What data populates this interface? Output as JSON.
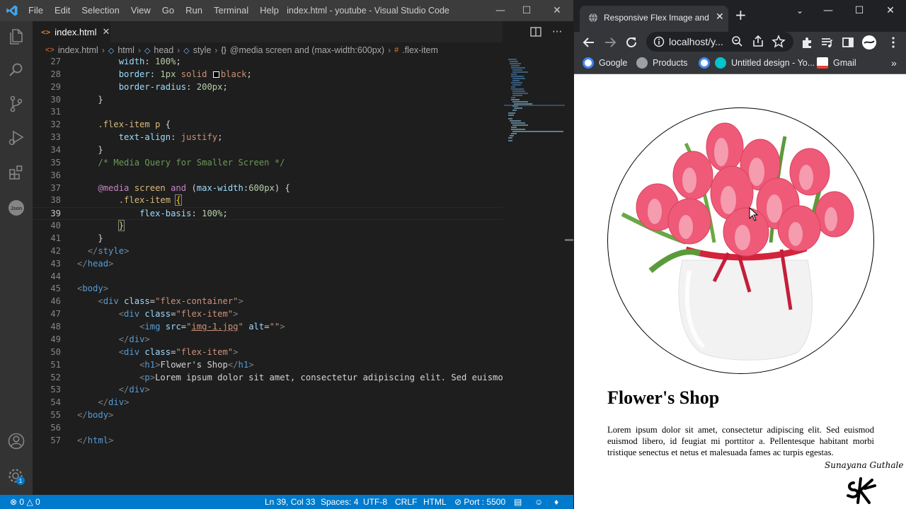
{
  "vscode": {
    "menu": [
      "File",
      "Edit",
      "Selection",
      "View",
      "Go",
      "Run",
      "Terminal",
      "Help"
    ],
    "window_title": "index.html - youtube - Visual Studio Code",
    "tab": {
      "label": "index.html",
      "icon": "html-file-icon"
    },
    "breadcrumb": [
      "index.html",
      "html",
      "head",
      "style",
      "@media screen and (max-width:600px)",
      ".flex-item"
    ],
    "activity_icons": [
      "explorer-icon",
      "search-icon",
      "source-control-icon",
      "run-debug-icon",
      "extensions-icon",
      "json-icon",
      "account-icon",
      "manage-gear-icon"
    ],
    "manage_badge": "1",
    "status": {
      "problems_errors": "0",
      "problems_warnings": "0",
      "position": "Ln 39, Col 33",
      "spaces": "Spaces: 4",
      "encoding": "UTF-8",
      "eol": "CRLF",
      "language": "HTML",
      "port": "Port : 5500"
    },
    "colors": {
      "statusbar": "#007acc",
      "activitybar": "#333333",
      "editor_bg": "#1e1e1e",
      "titlebar": "#3c3c3c"
    }
  },
  "code_lines": [
    {
      "n": "27",
      "tokens": [
        [
          "        ",
          "txt"
        ],
        [
          "width",
          "prop"
        ],
        [
          ": ",
          "txt"
        ],
        [
          "100%",
          "num"
        ],
        [
          ";",
          "txt"
        ]
      ]
    },
    {
      "n": "28",
      "tokens": [
        [
          "        ",
          "txt"
        ],
        [
          "border",
          "prop"
        ],
        [
          ": ",
          "txt"
        ],
        [
          "1px",
          "num"
        ],
        [
          " solid ",
          "str"
        ],
        [
          "#box",
          "box"
        ],
        [
          "black",
          "str"
        ],
        [
          ";",
          "txt"
        ]
      ]
    },
    {
      "n": "29",
      "tokens": [
        [
          "        ",
          "txt"
        ],
        [
          "border-radius",
          "prop"
        ],
        [
          ": ",
          "txt"
        ],
        [
          "200px",
          "num"
        ],
        [
          ";",
          "txt"
        ]
      ]
    },
    {
      "n": "30",
      "tokens": [
        [
          "    }",
          "txt"
        ]
      ]
    },
    {
      "n": "31",
      "tokens": []
    },
    {
      "n": "32",
      "tokens": [
        [
          "    ",
          "txt"
        ],
        [
          ".flex-item p",
          "sel"
        ],
        [
          " {",
          "txt"
        ]
      ]
    },
    {
      "n": "33",
      "tokens": [
        [
          "        ",
          "txt"
        ],
        [
          "text-align",
          "prop"
        ],
        [
          ": ",
          "txt"
        ],
        [
          "justify",
          "str"
        ],
        [
          ";",
          "txt"
        ]
      ]
    },
    {
      "n": "34",
      "tokens": [
        [
          "    }",
          "txt"
        ]
      ]
    },
    {
      "n": "35",
      "tokens": [
        [
          "    ",
          "txt"
        ],
        [
          "/* Media Query for Smaller Screen */",
          "com"
        ]
      ]
    },
    {
      "n": "36",
      "tokens": []
    },
    {
      "n": "37",
      "tokens": [
        [
          "    ",
          "txt"
        ],
        [
          "@media",
          "kw"
        ],
        [
          " screen ",
          "sel"
        ],
        [
          "and",
          "kw"
        ],
        [
          " (",
          "txt"
        ],
        [
          "max-width",
          "prop"
        ],
        [
          ":",
          "txt"
        ],
        [
          "600px",
          "num"
        ],
        [
          ") {",
          "txt"
        ]
      ]
    },
    {
      "n": "38",
      "tokens": [
        [
          "        ",
          "txt"
        ],
        [
          ".flex-item",
          "sel"
        ],
        [
          " ",
          "txt"
        ],
        [
          "{",
          "bbox"
        ]
      ]
    },
    {
      "n": "39",
      "tokens": [
        [
          "            ",
          "txt"
        ],
        [
          "flex-basis",
          "prop"
        ],
        [
          ": ",
          "txt"
        ],
        [
          "100%",
          "num"
        ],
        [
          ";",
          "txt"
        ]
      ],
      "current": true
    },
    {
      "n": "40",
      "tokens": [
        [
          "        ",
          "txt"
        ],
        [
          "}",
          "bbox"
        ]
      ]
    },
    {
      "n": "41",
      "tokens": [
        [
          "    }",
          "txt"
        ]
      ]
    },
    {
      "n": "42",
      "tokens": [
        [
          "  ",
          "txt"
        ],
        [
          "</",
          "punc"
        ],
        [
          "style",
          "tag"
        ],
        [
          ">",
          "punc"
        ]
      ]
    },
    {
      "n": "43",
      "tokens": [
        [
          "</",
          "punc"
        ],
        [
          "head",
          "tag"
        ],
        [
          ">",
          "punc"
        ]
      ]
    },
    {
      "n": "44",
      "tokens": []
    },
    {
      "n": "45",
      "tokens": [
        [
          "<",
          "punc"
        ],
        [
          "body",
          "tag"
        ],
        [
          ">",
          "punc"
        ]
      ]
    },
    {
      "n": "46",
      "tokens": [
        [
          "    ",
          "txt"
        ],
        [
          "<",
          "punc"
        ],
        [
          "div",
          "tag"
        ],
        [
          " ",
          "txt"
        ],
        [
          "class",
          "attr"
        ],
        [
          "=",
          "txt"
        ],
        [
          "\"flex-container\"",
          "str"
        ],
        [
          ">",
          "punc"
        ]
      ]
    },
    {
      "n": "47",
      "tokens": [
        [
          "        ",
          "txt"
        ],
        [
          "<",
          "punc"
        ],
        [
          "div",
          "tag"
        ],
        [
          " ",
          "txt"
        ],
        [
          "class",
          "attr"
        ],
        [
          "=",
          "txt"
        ],
        [
          "\"flex-item\"",
          "str"
        ],
        [
          ">",
          "punc"
        ]
      ]
    },
    {
      "n": "48",
      "tokens": [
        [
          "            ",
          "txt"
        ],
        [
          "<",
          "punc"
        ],
        [
          "img",
          "tag"
        ],
        [
          " ",
          "txt"
        ],
        [
          "src",
          "attr"
        ],
        [
          "=",
          "txt"
        ],
        [
          "\"",
          "str"
        ],
        [
          "img-1.jpg",
          "strul"
        ],
        [
          "\"",
          "str"
        ],
        [
          " ",
          "txt"
        ],
        [
          "alt",
          "attr"
        ],
        [
          "=",
          "txt"
        ],
        [
          "\"\"",
          "str"
        ],
        [
          ">",
          "punc"
        ]
      ]
    },
    {
      "n": "49",
      "tokens": [
        [
          "        ",
          "txt"
        ],
        [
          "</",
          "punc"
        ],
        [
          "div",
          "tag"
        ],
        [
          ">",
          "punc"
        ]
      ]
    },
    {
      "n": "50",
      "tokens": [
        [
          "        ",
          "txt"
        ],
        [
          "<",
          "punc"
        ],
        [
          "div",
          "tag"
        ],
        [
          " ",
          "txt"
        ],
        [
          "class",
          "attr"
        ],
        [
          "=",
          "txt"
        ],
        [
          "\"flex-item\"",
          "str"
        ],
        [
          ">",
          "punc"
        ]
      ]
    },
    {
      "n": "51",
      "tokens": [
        [
          "            ",
          "txt"
        ],
        [
          "<",
          "punc"
        ],
        [
          "h1",
          "tag"
        ],
        [
          ">",
          "punc"
        ],
        [
          "Flower's Shop",
          "txt"
        ],
        [
          "</",
          "punc"
        ],
        [
          "h1",
          "tag"
        ],
        [
          ">",
          "punc"
        ]
      ]
    },
    {
      "n": "52",
      "tokens": [
        [
          "            ",
          "txt"
        ],
        [
          "<",
          "punc"
        ],
        [
          "p",
          "tag"
        ],
        [
          ">",
          "punc"
        ],
        [
          "Lorem ipsum dolor sit amet, consectetur adipiscing elit. Sed euismod",
          "txt"
        ]
      ]
    },
    {
      "n": "53",
      "tokens": [
        [
          "        ",
          "txt"
        ],
        [
          "</",
          "punc"
        ],
        [
          "div",
          "tag"
        ],
        [
          ">",
          "punc"
        ]
      ]
    },
    {
      "n": "54",
      "tokens": [
        [
          "    ",
          "txt"
        ],
        [
          "</",
          "punc"
        ],
        [
          "div",
          "tag"
        ],
        [
          ">",
          "punc"
        ]
      ]
    },
    {
      "n": "55",
      "tokens": [
        [
          "</",
          "punc"
        ],
        [
          "body",
          "tag"
        ],
        [
          ">",
          "punc"
        ]
      ]
    },
    {
      "n": "56",
      "tokens": []
    },
    {
      "n": "57",
      "tokens": [
        [
          "</",
          "punc"
        ],
        [
          "html",
          "tag"
        ],
        [
          ">",
          "punc"
        ]
      ]
    }
  ],
  "chrome": {
    "tab_title": "Responsive Flex Image and Pa",
    "url": "localhost/y...",
    "bookmarks": [
      {
        "label": "Google",
        "icon": "google-icon",
        "color": "#4285f4"
      },
      {
        "label": "Products",
        "icon": "globe-icon",
        "color": "#9aa0a6"
      },
      {
        "label": "",
        "icon": "google-icon",
        "color": "#4285f4"
      },
      {
        "label": "Untitled design - Yo...",
        "icon": "canva-icon",
        "color": "#00c4cc"
      },
      {
        "label": "Gmail",
        "icon": "gmail-icon",
        "color": "#ea4335"
      }
    ],
    "page": {
      "heading": "Flower's Shop",
      "paragraph": "Lorem ipsum dolor sit amet, consectetur adipiscing elit. Sed euismod euismod libero, id feugiat mi porttitor a. Pellentesque habitant morbi tristique senectus et netus et malesuada fames ac turpis egestas.",
      "signature": "Sunayana Guthale",
      "image": "tulip-bouquet-in-white-vase"
    },
    "colors": {
      "tabstrip": "#202124",
      "toolbar": "#35363a",
      "page_bg": "#ffffff"
    }
  }
}
